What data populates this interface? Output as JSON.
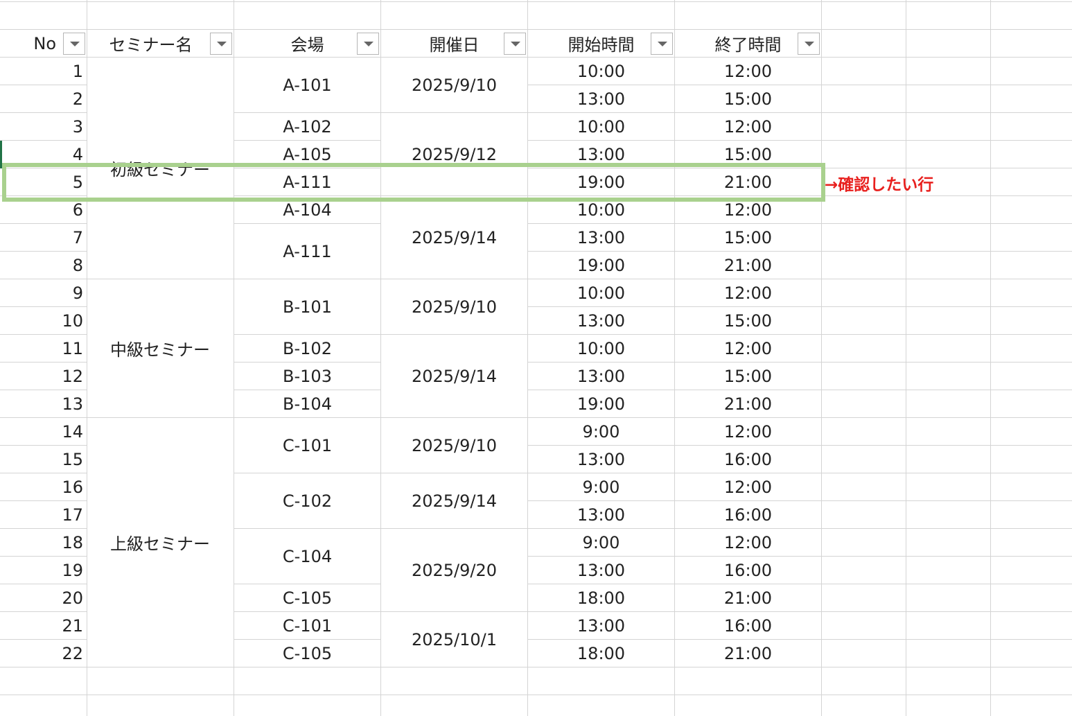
{
  "headers": {
    "no": "No",
    "seminar": "セミナー名",
    "venue": "会場",
    "date": "開催日",
    "start": "開始時間",
    "end": "終了時間"
  },
  "seminars": [
    "初級セミナー",
    "中級セミナー",
    "上級セミナー"
  ],
  "rows": [
    {
      "no": "1",
      "start": "10:00",
      "end": "12:00"
    },
    {
      "no": "2",
      "start": "13:00",
      "end": "15:00"
    },
    {
      "no": "3",
      "start": "10:00",
      "end": "12:00"
    },
    {
      "no": "4",
      "start": "13:00",
      "end": "15:00"
    },
    {
      "no": "5",
      "start": "19:00",
      "end": "21:00"
    },
    {
      "no": "6",
      "start": "10:00",
      "end": "12:00"
    },
    {
      "no": "7",
      "start": "13:00",
      "end": "15:00"
    },
    {
      "no": "8",
      "start": "19:00",
      "end": "21:00"
    },
    {
      "no": "9",
      "start": "10:00",
      "end": "12:00"
    },
    {
      "no": "10",
      "start": "13:00",
      "end": "15:00"
    },
    {
      "no": "11",
      "start": "10:00",
      "end": "12:00"
    },
    {
      "no": "12",
      "start": "13:00",
      "end": "15:00"
    },
    {
      "no": "13",
      "start": "19:00",
      "end": "21:00"
    },
    {
      "no": "14",
      "start": "9:00",
      "end": "12:00"
    },
    {
      "no": "15",
      "start": "13:00",
      "end": "16:00"
    },
    {
      "no": "16",
      "start": "9:00",
      "end": "12:00"
    },
    {
      "no": "17",
      "start": "13:00",
      "end": "16:00"
    },
    {
      "no": "18",
      "start": "9:00",
      "end": "12:00"
    },
    {
      "no": "19",
      "start": "13:00",
      "end": "16:00"
    },
    {
      "no": "20",
      "start": "18:00",
      "end": "21:00"
    },
    {
      "no": "21",
      "start": "13:00",
      "end": "16:00"
    },
    {
      "no": "22",
      "start": "18:00",
      "end": "21:00"
    }
  ],
  "venues": [
    "A-101",
    "A-102",
    "A-105",
    "A-111",
    "A-104",
    "A-111",
    "B-101",
    "B-102",
    "B-103",
    "B-104",
    "C-101",
    "C-102",
    "C-104",
    "C-105",
    "C-101",
    "C-105"
  ],
  "dates": [
    "2025/9/10",
    "2025/9/12",
    "2025/9/14",
    "2025/9/10",
    "2025/9/14",
    "2025/9/10",
    "2025/9/14",
    "2025/9/20",
    "2025/10/1"
  ],
  "annotation": "→確認したい行",
  "colors": {
    "highlight_border": "#a9d18e",
    "annotation_text": "#e8201e",
    "grid": "#d4d4d4"
  }
}
